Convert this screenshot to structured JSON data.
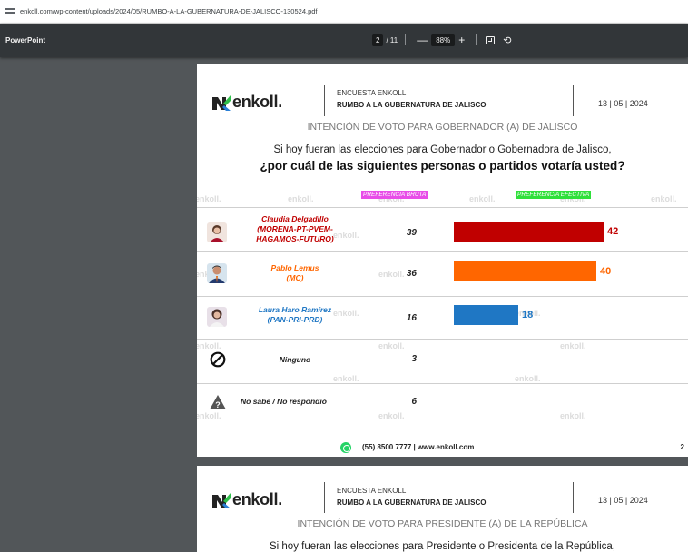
{
  "browser": {
    "url": "enkoll.com/wp-content/uploads/2024/05/RUMBO-A-LA-GUBERNATURA-DE-JALISCO-130524.pdf"
  },
  "viewer": {
    "doc_title": "PowerPoint",
    "page_current": "2",
    "page_total": "/ 11",
    "zoom_out": "—",
    "zoom": "88%",
    "zoom_in": "+",
    "fit_icon": "fit-page-icon",
    "rotate_icon": "rotate-icon",
    "rotate_glyph": "⟲"
  },
  "page1": {
    "logo_text": "enkoll.",
    "encuesta": "ENCUESTA ENKOLL",
    "rumbo": "RUMBO A LA GUBERNATURA DE JALISCO",
    "date": "13 | 05 | 2024",
    "title": "INTENCIÓN DE VOTO PARA GOBERNADOR (A) DE JALISCO",
    "question_line1": "Si hoy fueran las elecciones para Gobernador o Gobernadora de Jalisco,",
    "question_line2": "¿por cuál de las siguientes personas o partidos votaría usted?",
    "watermark": "enkoll.",
    "header_bruta": "PREFERENCIA BRUTA",
    "header_efectiva": "PREFERENCIA EFECTIVA",
    "footer_phone": "(55) 8500 7777   |   www.enkoll.com",
    "page_number": "2",
    "colors": {
      "morena": "#c00000",
      "mc": "#ff6600",
      "pan": "#1f77c4"
    }
  },
  "rows": [
    {
      "name": "Claudia Delgadillo\n(MORENA-PT-PVEM-\nHAGAMOS-FUTURO)",
      "bruta": "39",
      "efectiva": "42",
      "color": "#c00000",
      "icon": "candidate-photo"
    },
    {
      "name": "Pablo Lemus\n(MC)",
      "bruta": "36",
      "efectiva": "40",
      "color": "#ff6600",
      "icon": "candidate-photo"
    },
    {
      "name": "Laura Haro Ramírez\n(PAN-PRI-PRD)",
      "bruta": "16",
      "efectiva": "18",
      "color": "#1f77c4",
      "icon": "candidate-photo"
    },
    {
      "name": "Ninguno",
      "bruta": "3",
      "icon": "prohibited-icon"
    },
    {
      "name": "No sabe / No respondió",
      "bruta": "6",
      "icon": "warning-icon"
    }
  ],
  "chart_data": {
    "type": "bar",
    "categories": [
      "Claudia Delgadillo (MORENA-PT-PVEM-HAGAMOS-FUTURO)",
      "Pablo Lemus (MC)",
      "Laura Haro Ramírez (PAN-PRI-PRD)",
      "Ninguno",
      "No sabe / No respondió"
    ],
    "series": [
      {
        "name": "PREFERENCIA BRUTA",
        "values": [
          39,
          36,
          16,
          3,
          6
        ]
      },
      {
        "name": "PREFERENCIA EFECTIVA",
        "values": [
          42,
          40,
          18,
          null,
          null
        ]
      }
    ],
    "title": "INTENCIÓN DE VOTO PARA GOBERNADOR (A) DE JALISCO",
    "ylim": [
      0,
      42
    ]
  },
  "page2": {
    "logo_text": "enkoll.",
    "encuesta": "ENCUESTA ENKOLL",
    "rumbo": "RUMBO A LA GUBERNATURA DE JALISCO",
    "date": "13 | 05 | 2024",
    "title": "INTENCIÓN DE VOTO PARA PRESIDENTE (A) DE LA REPÚBLICA",
    "question_line1": "Si hoy fueran las elecciones para Presidente o Presidenta de la República,"
  }
}
